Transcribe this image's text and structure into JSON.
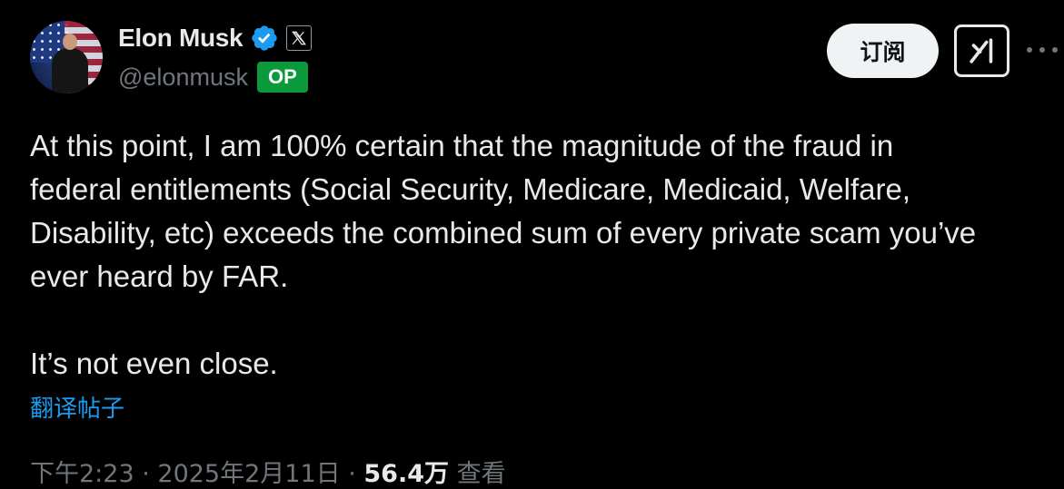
{
  "author": {
    "name": "Elon Musk",
    "handle": "@elonmusk",
    "op_badge": "OP",
    "verified_icon": "verified-badge-icon",
    "affiliation_icon": "x-logo-icon",
    "avatar_icon": "avatar"
  },
  "actions": {
    "subscribe_label": "订阅",
    "grok_icon": "grok-icon",
    "more_icon": "more-icon"
  },
  "tweet": {
    "text": "At this point, I am 100% certain that the magnitude of the fraud in\nfederal entitlements (Social Security, Medicare, Medicaid, Welfare,\nDisability, etc) exceeds the combined sum of every private scam you’ve\never heard by FAR.\n\nIt’s not even close.",
    "translate_label": "翻译帖子"
  },
  "meta": {
    "time": "下午2:23",
    "sep1": " · ",
    "date": "2025年2月11日",
    "sep2": " · ",
    "views": "56.4万",
    "views_label": " 查看"
  },
  "colors": {
    "background": "#000000",
    "text": "#e7e9ea",
    "secondary": "#71767b",
    "link": "#1d9bf0",
    "verified": "#1d9bf0",
    "op_badge": "#0a9a3c"
  }
}
